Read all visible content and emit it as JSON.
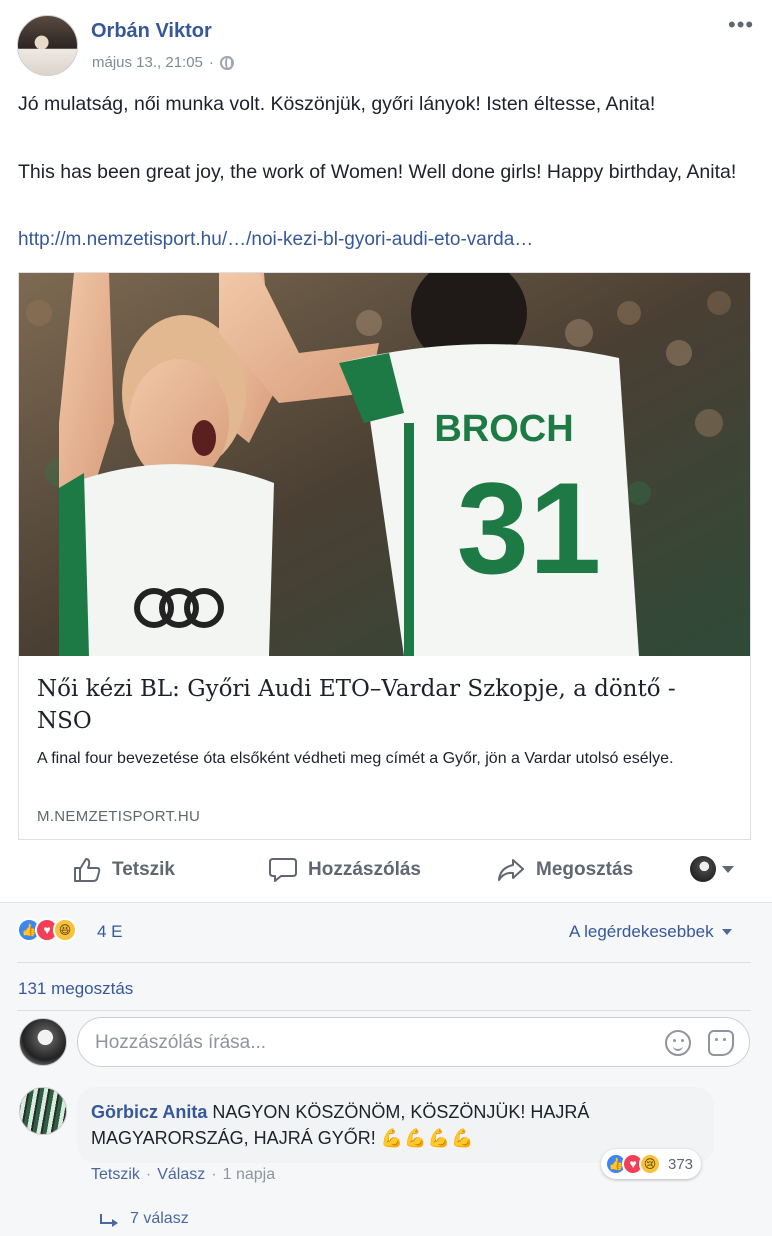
{
  "post": {
    "author": "Orbán Viktor",
    "timestamp": "május 13., 21:05",
    "separator": "·",
    "text_hu": "Jó mulatság, női munka volt. Köszönjük, győri lányok! Isten éltesse, Anita!",
    "text_en": "This has been great joy, the work of Women! Well done girls! Happy birthday, Anita!",
    "link": "http://m.nemzetisport.hu/…/noi-kezi-bl-gyori-audi-eto-varda…"
  },
  "card": {
    "image": {
      "jersey_name": "BROCH",
      "jersey_number": "31"
    },
    "title": "Női kézi BL: Győri Audi ETO–Vardar Szkopje, a döntő - NSO",
    "description": "A final four bevezetése óta elsőként védheti meg címét a Győr, jön a Vardar utolsó esélye.",
    "domain": "M.NEMZETISPORT.HU"
  },
  "actions": {
    "like": "Tetszik",
    "comment": "Hozzászólás",
    "share": "Megosztás"
  },
  "stats": {
    "reaction_count": "4 E",
    "sort_label": "A legérdekesebbek",
    "shares": "131 megosztás"
  },
  "composer": {
    "placeholder": "Hozzászólás írása..."
  },
  "comment": {
    "author": "Görbicz Anita",
    "text": "NAGYON KÖSZÖNÖM, KÖSZÖNJÜK! HAJRÁ MAGYARORSZÁG, HAJRÁ GYŐR!",
    "emojis": "💪💪💪💪",
    "reaction_count": "373",
    "like_label": "Tetszik",
    "reply_label": "Válasz",
    "age": "1 napja",
    "replies": "7 válasz"
  },
  "colors": {
    "link_blue": "#365899",
    "like_blue": "#3b87f6",
    "love_red": "#f33e58",
    "haha_yellow": "#f7c33b",
    "jersey_green": "#1e7a44"
  }
}
